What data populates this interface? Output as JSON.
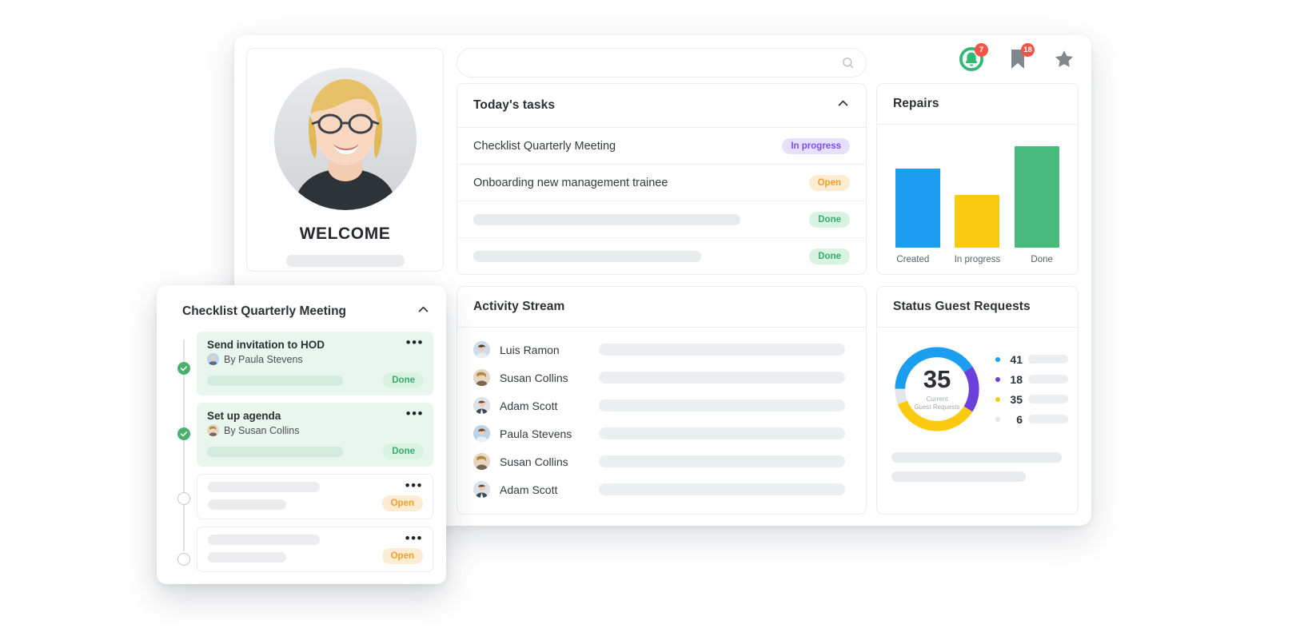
{
  "search": {
    "value": "",
    "placeholder": "",
    "icon": "search-icon"
  },
  "header_icons": [
    {
      "name": "notification-bell-icon",
      "badge": "7"
    },
    {
      "name": "bookmark-icon",
      "badge": "18"
    },
    {
      "name": "star-icon",
      "badge": ""
    }
  ],
  "profile": {
    "welcome": "WELCOME",
    "avatar": "user-avatar"
  },
  "todays_tasks": {
    "title": "Today's tasks",
    "collapse_icon": "chevron-up-icon",
    "rows": [
      {
        "label": "Checklist Quarterly Meeting",
        "status": "In progress",
        "status_type": "prog",
        "placeholder": false
      },
      {
        "label": "Onboarding new management trainee",
        "status": "Open",
        "status_type": "open",
        "placeholder": false
      },
      {
        "label": "",
        "status": "Done",
        "status_type": "done",
        "placeholder": true
      },
      {
        "label": "",
        "status": "Done",
        "status_type": "done",
        "placeholder": true
      }
    ]
  },
  "repairs": {
    "title": "Repairs",
    "chart_data": {
      "type": "bar",
      "title": "Repairs",
      "categories": [
        "Created",
        "In progress",
        "Done"
      ],
      "values": [
        78,
        52,
        100
      ],
      "colors": [
        "#1b9df0",
        "#fbc90d",
        "#47ba7c"
      ],
      "xlabel": "",
      "ylabel": "",
      "ylim": [
        0,
        110
      ],
      "grid": false,
      "legend": "none"
    }
  },
  "activity_stream": {
    "title": "Activity Stream",
    "rows": [
      {
        "name": "Luis Ramon",
        "avatar": "avatar-luis-ramon"
      },
      {
        "name": "Susan Collins",
        "avatar": "avatar-susan-collins"
      },
      {
        "name": "Adam Scott",
        "avatar": "avatar-adam-scott"
      },
      {
        "name": "Paula Stevens",
        "avatar": "avatar-paula-stevens"
      },
      {
        "name": "Susan Collins",
        "avatar": "avatar-susan-collins"
      },
      {
        "name": "Adam Scott",
        "avatar": "avatar-adam-scott"
      }
    ]
  },
  "status_guest_requests": {
    "title": "Status Guest Requests",
    "center_value": "35",
    "center_caption_1": "Current",
    "center_caption_2": "Guest Requests",
    "chart_data": {
      "type": "pie",
      "title": "Status Guest Requests",
      "labels": [
        "41",
        "18",
        "35",
        "6"
      ],
      "values": [
        41,
        18,
        35,
        6
      ],
      "colors": [
        "#1b9df0",
        "#6b3fdb",
        "#fbc90d",
        "#e3e5e8"
      ],
      "center_label": "35",
      "legend": "right",
      "donut": true
    }
  },
  "checklist": {
    "title": "Checklist Quarterly Meeting",
    "collapse_icon": "chevron-up-icon",
    "menu_icon": "more-options-icon",
    "items": [
      {
        "title": "Send invitation to HOD",
        "by": "By Paula Stevens",
        "status": "Done",
        "state": "done",
        "placeholder": false
      },
      {
        "title": "Set up agenda",
        "by": "By Susan Collins",
        "status": "Done",
        "state": "done",
        "placeholder": false
      },
      {
        "title": "",
        "by": "",
        "status": "Open",
        "state": "open",
        "placeholder": true
      },
      {
        "title": "",
        "by": "",
        "status": "Open",
        "state": "open",
        "placeholder": true
      }
    ]
  },
  "colors": {
    "blue": "#1b9df0",
    "yellow": "#fbc90d",
    "green": "#47ba7c",
    "purple": "#6b3fdb",
    "gray": "#e3e5e8",
    "badge_red": "#f0544a",
    "bell_green": "#2fb972"
  }
}
